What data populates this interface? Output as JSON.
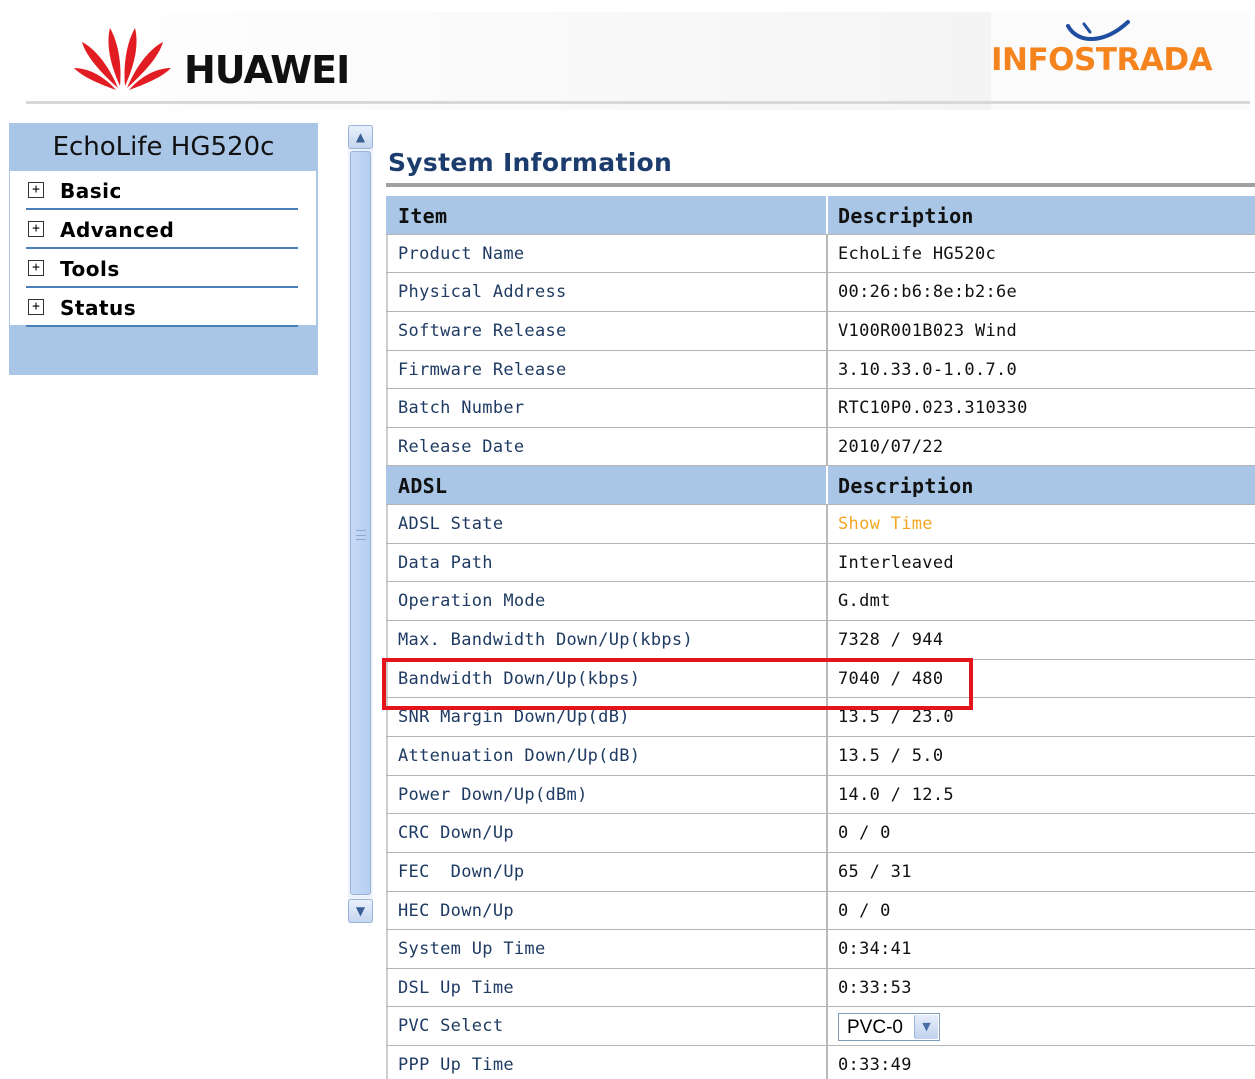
{
  "header": {
    "brand": "HUAWEI",
    "partner": "INFOSTRADA",
    "colors": {
      "partner_orange": "#f5841f",
      "huawei_red": "#e21c23"
    }
  },
  "sidebar": {
    "title": "EchoLife HG520c",
    "items": [
      {
        "icon": "plus-box-icon",
        "label": "Basic"
      },
      {
        "icon": "plus-box-icon",
        "label": "Advanced"
      },
      {
        "icon": "plus-box-icon",
        "label": "Tools"
      },
      {
        "icon": "plus-box-icon",
        "label": "Status"
      }
    ]
  },
  "scrollbar": {
    "up_icon": "chevron-up-icon",
    "down_icon": "chevron-down-icon"
  },
  "page_title": "System Information",
  "system_table": {
    "headers": [
      "Item",
      "Description"
    ],
    "rows": [
      {
        "item": "Product Name",
        "value": "EchoLife HG520c"
      },
      {
        "item": "Physical Address",
        "value": "00:26:b6:8e:b2:6e"
      },
      {
        "item": "Software Release",
        "value": "V100R001B023 Wind"
      },
      {
        "item": "Firmware Release",
        "value": "3.10.33.0-1.0.7.0"
      },
      {
        "item": "Batch Number",
        "value": "RTC10P0.023.310330"
      },
      {
        "item": "Release Date",
        "value": "2010/07/22"
      }
    ]
  },
  "adsl_table": {
    "headers": [
      "ADSL",
      "Description"
    ],
    "rows": [
      {
        "item": "ADSL State",
        "value": "Show Time"
      },
      {
        "item": "Data Path",
        "value": "Interleaved"
      },
      {
        "item": "Operation Mode",
        "value": "G.dmt"
      },
      {
        "item": "Max. Bandwidth Down/Up(kbps)",
        "value": "7328 / 944"
      },
      {
        "item": "Bandwidth Down/Up(kbps)",
        "value": "7040 / 480"
      },
      {
        "item": "SNR Margin Down/Up(dB)",
        "value": "13.5 / 23.0"
      },
      {
        "item": "Attenuation Down/Up(dB)",
        "value": "13.5 / 5.0"
      },
      {
        "item": "Power Down/Up(dBm)",
        "value": "14.0 / 12.5"
      },
      {
        "item": "CRC Down/Up",
        "value": "0 / 0"
      },
      {
        "item": "FEC  Down/Up",
        "value": "65 / 31"
      },
      {
        "item": "HEC Down/Up",
        "value": "0 / 0"
      },
      {
        "item": "System Up Time",
        "value": "0:34:41"
      },
      {
        "item": "DSL Up Time",
        "value": "0:33:53"
      },
      {
        "item": "PVC Select",
        "value": "PVC-0"
      },
      {
        "item": "PPP Up Time",
        "value": "0:33:49"
      }
    ]
  },
  "colors": {
    "state_orange": "#f5a623",
    "highlight_red": "#e4141b",
    "header_blue": "#a9c6e6"
  }
}
